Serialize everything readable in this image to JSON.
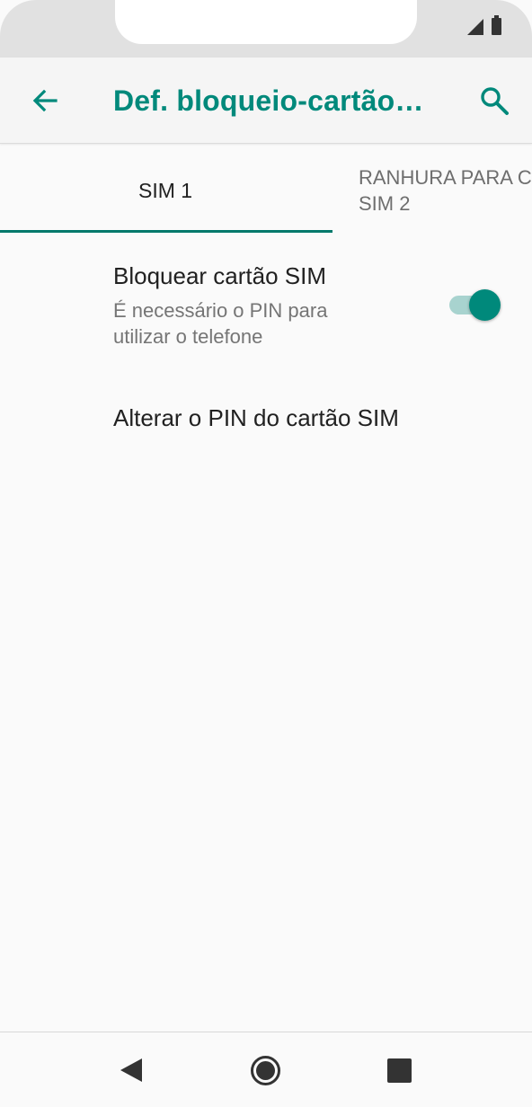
{
  "app_bar": {
    "title": "Def. bloqueio-cartão…",
    "back_icon": "arrow-back-icon",
    "search_icon": "search-icon"
  },
  "tabs": [
    {
      "label": "SIM 1",
      "selected": true
    },
    {
      "label": "RANHURA PARA C\nSIM 2",
      "selected": false
    }
  ],
  "preferences": {
    "lock_sim": {
      "title": "Bloquear cartão SIM",
      "summary": "É necessário o PIN para utilizar o telefone",
      "enabled": true
    },
    "change_pin": {
      "title": "Alterar o PIN do cartão SIM"
    }
  },
  "colors": {
    "accent": "#00897b",
    "toggle_track": "#a8d3cf",
    "text_primary": "#212121",
    "text_secondary": "#757575"
  }
}
